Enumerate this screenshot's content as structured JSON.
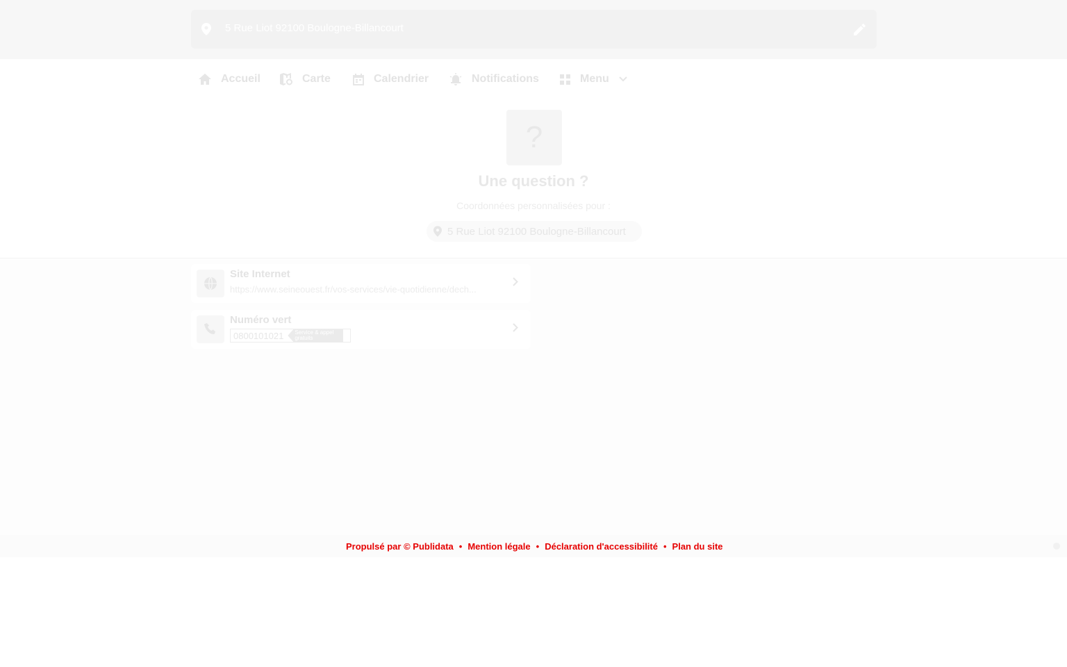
{
  "header": {
    "address": "5 Rue Liot 92100 Boulogne-Billancourt",
    "icons": {
      "location": "map-pin-icon",
      "edit": "pencil-icon"
    }
  },
  "nav": {
    "items": [
      {
        "label": "Accueil",
        "icon": "home-icon"
      },
      {
        "label": "Carte",
        "icon": "map-icon"
      },
      {
        "label": "Calendrier",
        "icon": "calendar-icon"
      },
      {
        "label": "Notifications",
        "icon": "bell-alert-icon"
      },
      {
        "label": "Menu",
        "icon": "grid-icon",
        "chevron": "chevron-down-icon"
      }
    ]
  },
  "question": {
    "symbol": "?",
    "title": "Une question ?",
    "subtitle": "Coordonnées personnalisées pour :",
    "address": "5 Rue Liot 92100 Boulogne-Billancourt"
  },
  "cards": [
    {
      "title": "Site Internet",
      "subtitle": "https://www.seineouest.fr/vos-services/vie-quotidienne/dech...",
      "icon": "globe-icon"
    },
    {
      "title": "Numéro vert",
      "number": "0800101021",
      "tag_line1": "Service & appel",
      "tag_line2": "gratuits",
      "icon": "phone-icon"
    }
  ],
  "footer": {
    "links": [
      "Propulsé par © Publidata",
      "Mention légale",
      "Déclaration d'accessibilité",
      "Plan du site"
    ],
    "separator": "•"
  },
  "colors": {
    "accent_red": "#e60000",
    "header_bg": "#f7f7f7",
    "bar_bg": "#f2f2f2"
  }
}
